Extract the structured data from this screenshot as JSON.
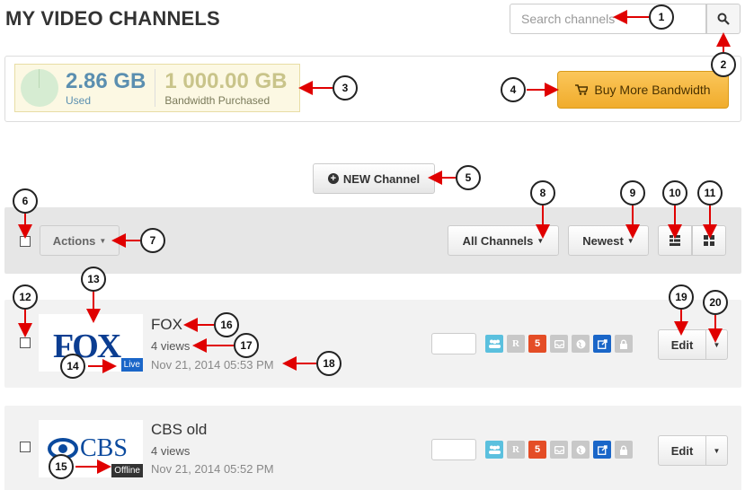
{
  "page": {
    "title": "MY VIDEO CHANNELS"
  },
  "search": {
    "placeholder": "Search channels"
  },
  "bandwidth": {
    "used_value": "2.86 GB",
    "used_label": "Used",
    "purchased_value": "1 000.00 GB",
    "purchased_label": "Bandwidth Purchased",
    "buy_label": "Buy More Bandwidth"
  },
  "actions": {
    "new_channel_label": "NEW Channel",
    "actions_label": "Actions",
    "filter_label": "All Channels",
    "sort_label": "Newest"
  },
  "channels": [
    {
      "logo_text": "FOX",
      "title": "FOX",
      "views": "4 views",
      "date": "Nov 21, 2014 05:53 PM",
      "status": "Live",
      "edit_label": "Edit"
    },
    {
      "logo_text": "CBS",
      "title": "CBS old",
      "views": "4 views",
      "date": "Nov 21, 2014 05:52 PM",
      "status": "Offline",
      "edit_label": "Edit"
    }
  ],
  "status_icons": [
    {
      "name": "users-icon",
      "color": "#5bc0de",
      "glyph": ""
    },
    {
      "name": "r-icon",
      "color": "#c8c8c8",
      "glyph": "R"
    },
    {
      "name": "html5-icon",
      "color": "#e44d26",
      "glyph": "5"
    },
    {
      "name": "inbox-icon",
      "color": "#c8c8c8",
      "glyph": ""
    },
    {
      "name": "globe-icon",
      "color": "#c8c8c8",
      "glyph": ""
    },
    {
      "name": "external-link-icon",
      "color": "#1a66c8",
      "glyph": ""
    },
    {
      "name": "lock-icon",
      "color": "#c8c8c8",
      "glyph": ""
    }
  ],
  "callouts": [
    "1",
    "2",
    "3",
    "4",
    "5",
    "6",
    "7",
    "8",
    "9",
    "10",
    "11",
    "12",
    "13",
    "14",
    "15",
    "16",
    "17",
    "18",
    "19",
    "20"
  ],
  "colors": {
    "accent": "#f0ac2c",
    "live": "#1a66c8",
    "arrow": "#e00000"
  }
}
